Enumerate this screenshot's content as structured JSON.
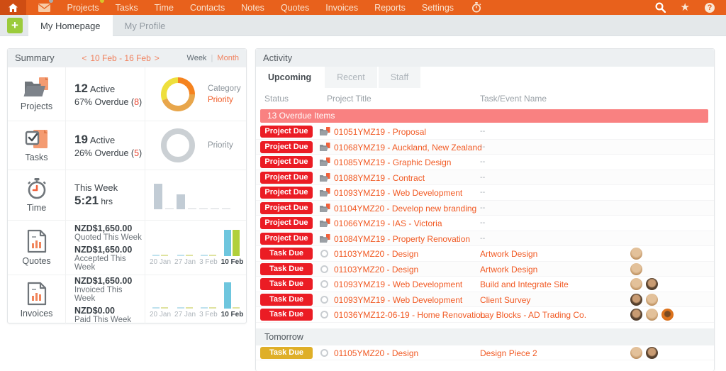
{
  "colors": {
    "nav_orange": "#E8611C",
    "accent_orange": "#F15A24",
    "badge_red": "#EB1C24",
    "badge_yellow": "#DFAF28",
    "banner_salmon": "#F98181",
    "teal": "#6EC6DE",
    "lime": "#B1D03C",
    "donut_orange": "#F5831F",
    "donut_tan": "#E8A64B",
    "donut_yellow": "#EEDF3D",
    "donut_gray": "#CBD0D4",
    "time_bar": "#C2CCD5",
    "plus_green": "#9BCB3B"
  },
  "nav": {
    "items": [
      {
        "label": "Projects",
        "dot": true
      },
      {
        "label": "Tasks"
      },
      {
        "label": "Time"
      },
      {
        "label": "Contacts"
      },
      {
        "label": "Notes"
      },
      {
        "label": "Quotes"
      },
      {
        "label": "Invoices"
      },
      {
        "label": "Reports"
      },
      {
        "label": "Settings"
      }
    ],
    "envelope_badge": true,
    "help_glyph": "?",
    "star_glyph": "★"
  },
  "tabbar": {
    "plus": "+",
    "tabs": [
      {
        "label": "My Homepage",
        "active": true
      },
      {
        "label": "My Profile",
        "active": false
      }
    ]
  },
  "summary": {
    "title": "Summary",
    "date_prev": "<",
    "date_range": "10 Feb - 16 Feb",
    "date_next": ">",
    "week": "Week",
    "divider": "|",
    "month": "Month",
    "projects": {
      "label": "Projects",
      "count": "12",
      "count_suffix": " Active",
      "overdue_pre": "67% Overdue (",
      "overdue_num": "8",
      "overdue_post": ")",
      "legend_category": "Category",
      "legend_priority": "Priority",
      "donut_segments": [
        {
          "name": "orange",
          "pct": 25
        },
        {
          "name": "tan",
          "pct": 44
        },
        {
          "name": "yellow",
          "pct": 31
        }
      ]
    },
    "tasks": {
      "label": "Tasks",
      "count": "19",
      "count_suffix": " Active",
      "overdue_pre": "26% Overdue (",
      "overdue_num": "5",
      "overdue_post": ")",
      "legend_priority": "Priority"
    },
    "time": {
      "label": "Time",
      "line1": "This Week",
      "value": "5:21",
      "unit": " hrs",
      "chart": {
        "values": [
          100,
          0,
          58,
          0,
          0,
          0,
          0
        ]
      }
    },
    "quotes": {
      "label": "Quotes",
      "value1": "NZD$1,650.00",
      "label1": "Quoted This Week",
      "value2": "NZD$1,650.00",
      "label2": "Accepted This Week",
      "chart": {
        "categories": [
          "20 Jan",
          "27 Jan",
          "3 Feb",
          "10 Feb"
        ],
        "series": [
          {
            "name": "quoted",
            "color": "teal",
            "values": [
              0,
              0,
              0,
              100
            ]
          },
          {
            "name": "accepted",
            "color": "lime",
            "values": [
              0,
              0,
              0,
              100
            ]
          }
        ]
      }
    },
    "invoices": {
      "label": "Invoices",
      "value1": "NZD$1,650.00",
      "label1": "Invoiced This Week",
      "value2": "NZD$0.00",
      "label2": "Paid This Week",
      "chart": {
        "categories": [
          "20 Jan",
          "27 Jan",
          "3 Feb",
          "10 Feb"
        ],
        "series": [
          {
            "name": "invoiced",
            "color": "teal",
            "values": [
              0,
              0,
              0,
              100
            ]
          },
          {
            "name": "paid",
            "color": "lime",
            "values": [
              0,
              0,
              0,
              0
            ]
          }
        ]
      }
    }
  },
  "activity": {
    "title": "Activity",
    "tabs": [
      {
        "label": "Upcoming",
        "active": true
      },
      {
        "label": "Recent",
        "active": false
      },
      {
        "label": "Staff",
        "active": false
      }
    ],
    "columns": {
      "status": "Status",
      "project": "Project Title",
      "task": "Task/Event Name"
    },
    "overdue_banner": "13 Overdue Items",
    "tomorrow_label": "Tomorrow",
    "overdue_rows": [
      {
        "badge": "Project Due",
        "badge_type": "red",
        "kind": "project",
        "title": "01051YMZ19 - Proposal",
        "task": "--",
        "avatars": []
      },
      {
        "badge": "Project Due",
        "badge_type": "red",
        "kind": "project",
        "title": "01068YMZ19 - Auckland, New Zealand",
        "task": "--",
        "avatars": []
      },
      {
        "badge": "Project Due",
        "badge_type": "red",
        "kind": "project",
        "title": "01085YMZ19 - Graphic Design",
        "task": "--",
        "avatars": []
      },
      {
        "badge": "Project Due",
        "badge_type": "red",
        "kind": "project",
        "title": "01088YMZ19 - Contract",
        "task": "--",
        "avatars": []
      },
      {
        "badge": "Project Due",
        "badge_type": "red",
        "kind": "project",
        "title": "01093YMZ19 - Web Development",
        "task": "--",
        "avatars": []
      },
      {
        "badge": "Project Due",
        "badge_type": "red",
        "kind": "project",
        "title": "01104YMZ20 - Develop new branding",
        "task": "--",
        "avatars": []
      },
      {
        "badge": "Project Due",
        "badge_type": "red",
        "kind": "project",
        "title": "01066YMZ19 - IAS - Victoria",
        "task": "--",
        "avatars": []
      },
      {
        "badge": "Project Due",
        "badge_type": "red",
        "kind": "project",
        "title": "01084YMZ19 - Property Renovation",
        "task": "--",
        "avatars": []
      },
      {
        "badge": "Task Due",
        "badge_type": "red",
        "kind": "task",
        "title": "01103YMZ20 - Design",
        "task": "Artwork Design",
        "avatars": [
          "blonde"
        ]
      },
      {
        "badge": "Task Due",
        "badge_type": "red",
        "kind": "task",
        "title": "01103YMZ20 - Design",
        "task": "Artwork Design",
        "avatars": [
          "blonde"
        ]
      },
      {
        "badge": "Task Due",
        "badge_type": "red",
        "kind": "task",
        "title": "01093YMZ19 - Web Development",
        "task": "Build and Integrate Site",
        "avatars": [
          "blonde",
          "brunette"
        ]
      },
      {
        "badge": "Task Due",
        "badge_type": "red",
        "kind": "task",
        "title": "01093YMZ19 - Web Development",
        "task": "Client Survey",
        "avatars": [
          "brunette",
          "blonde"
        ]
      },
      {
        "badge": "Task Due",
        "badge_type": "red",
        "kind": "task",
        "title": "01036YMZ12-06-19 - Home Renovation",
        "task": "Lay Blocks - AD Trading Co.",
        "avatars": [
          "brunette",
          "blonde",
          "orange"
        ]
      }
    ],
    "tomorrow_rows": [
      {
        "badge": "Task Due",
        "badge_type": "yellow",
        "kind": "task",
        "title": "01105YMZ20 - Design",
        "task": "Design Piece 2",
        "avatars": [
          "blonde",
          "brunette"
        ]
      }
    ]
  }
}
